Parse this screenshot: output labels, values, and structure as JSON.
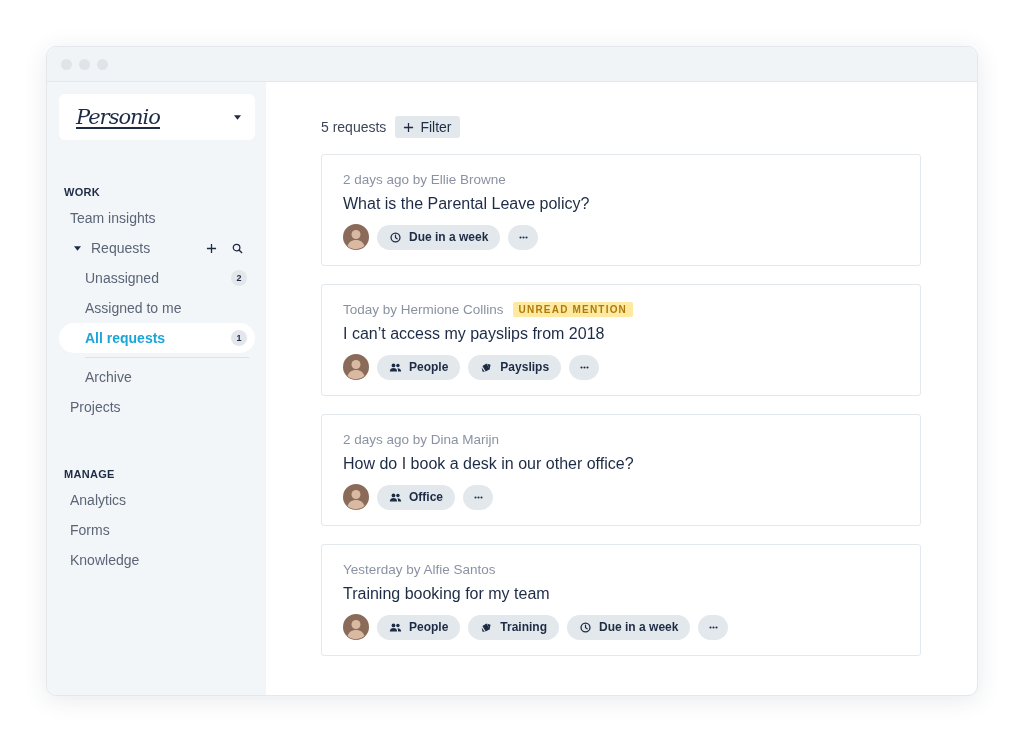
{
  "sidebar": {
    "logo": "Personio",
    "sections": [
      {
        "title": "WORK",
        "items": [
          {
            "label": "Team insights",
            "selected": false
          },
          {
            "label": "Requests",
            "selected": false,
            "expanded": true,
            "children": [
              {
                "label": "Unassigned",
                "selected": false,
                "separated": false,
                "badge": "2"
              },
              {
                "label": "Assigned to me",
                "selected": false,
                "separated": false
              },
              {
                "label": "All requests",
                "selected": true,
                "separated": false,
                "badge": "1"
              },
              {
                "label": "Archive",
                "selected": false,
                "separated": true
              }
            ]
          },
          {
            "label": "Projects",
            "selected": false
          }
        ]
      },
      {
        "title": "MANAGE",
        "items": [
          {
            "label": "Analytics",
            "selected": false
          },
          {
            "label": "Forms",
            "selected": false
          },
          {
            "label": "Knowledge",
            "selected": false
          }
        ]
      }
    ]
  },
  "toolbar": {
    "count": "5 requests",
    "filter": "Filter"
  },
  "requests": [
    {
      "meta": "2 days ago by Ellie Browne",
      "title": "What is the Parental Leave policy?",
      "tags": [
        {
          "kind": "due",
          "label": "Due in a week"
        }
      ]
    },
    {
      "meta": "Today by Hermione Collins",
      "badge": "UNREAD MENTION",
      "title": "I can’t access my payslips from 2018",
      "tags": [
        {
          "kind": "people",
          "label": "People"
        },
        {
          "kind": "folder",
          "label": "Payslips"
        }
      ]
    },
    {
      "meta": "2 days ago by Dina Marijn",
      "title": "How do I book a desk in our other office?",
      "tags": [
        {
          "kind": "people",
          "label": "Office"
        }
      ]
    },
    {
      "meta": "Yesterday by Alfie Santos",
      "title": "Training booking for my team",
      "tags": [
        {
          "kind": "people",
          "label": "People"
        },
        {
          "kind": "folder",
          "label": "Training"
        },
        {
          "kind": "due",
          "label": "Due in a week"
        }
      ]
    }
  ]
}
